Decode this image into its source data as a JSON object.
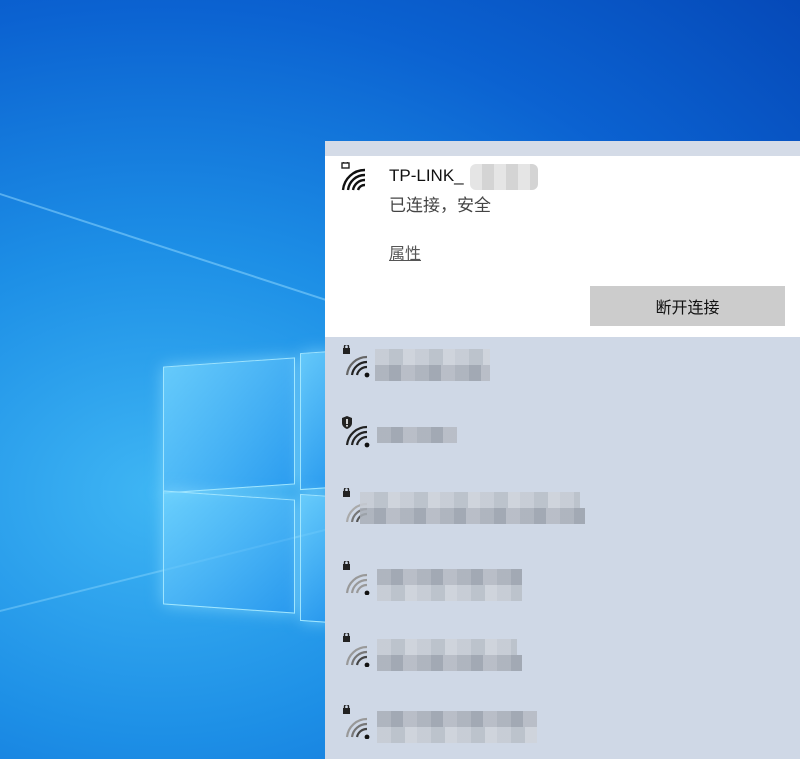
{
  "connected_network": {
    "ssid": "TP-LINK_",
    "status": "已连接，安全",
    "properties_link": "属性",
    "disconnect_button": "断开连接"
  },
  "other_networks": [
    {
      "secured": true,
      "shield_warning": false
    },
    {
      "secured": false,
      "shield_warning": true
    },
    {
      "secured": true,
      "shield_warning": false
    },
    {
      "secured": true,
      "shield_warning": false
    },
    {
      "secured": true,
      "shield_warning": false
    },
    {
      "secured": true,
      "shield_warning": false
    }
  ],
  "icons": {
    "wifi": "wifi-signal-icon",
    "lock": "lock-icon",
    "shield": "shield-warning-icon"
  },
  "colors": {
    "flyout_bg": "#cfd8e6",
    "connected_bg": "#ffffff",
    "button_bg": "#cccccc",
    "desktop_accent": "#1d8fe6"
  }
}
